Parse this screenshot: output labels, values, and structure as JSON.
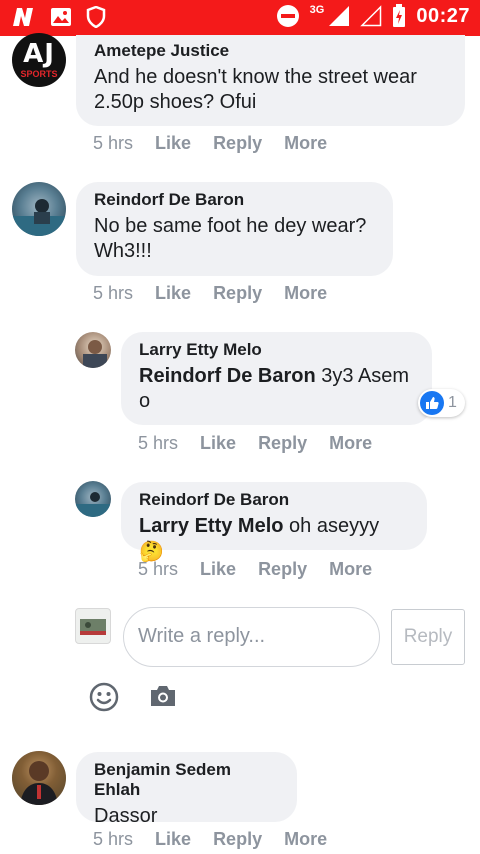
{
  "status_bar": {
    "network": "3G",
    "time": "00:27",
    "color": "#f41a1a"
  },
  "comments": [
    {
      "author": "Ametepe Justice",
      "text": "And he doesn't know the street wear 2.50p shoes? Ofui",
      "line1": "And he doesn't know the street wear",
      "line2": "2.50p shoes? Ofui",
      "time": "5 hrs",
      "like": "Like",
      "reply": "Reply",
      "more": "More",
      "avatar_text": "AJ",
      "avatar_sub": "SPORTS"
    },
    {
      "author": "Reindorf De Baron",
      "line1": "No be same foot he dey wear?",
      "line2": "Wh3!!!",
      "time": "5 hrs",
      "like": "Like",
      "reply": "Reply",
      "more": "More"
    },
    {
      "author": "Larry Etty Melo",
      "mention": "Reindorf De Baron",
      "line1_rest": " 3y3 Asem",
      "line2": "o",
      "reaction_count": "1",
      "time": "5 hrs",
      "like": "Like",
      "reply": "Reply",
      "more": "More"
    },
    {
      "author": "Reindorf De Baron",
      "mention": "Larry Etty Melo",
      "line1_rest": " oh aseyyy",
      "emoji": "🤔",
      "time": "5 hrs",
      "like": "Like",
      "reply": "Reply",
      "more": "More"
    },
    {
      "author": "Benjamin Sedem Ehlah",
      "line1": "Dassor",
      "time": "5 hrs",
      "like": "Like",
      "reply": "Reply",
      "more": "More"
    }
  ],
  "reply_composer": {
    "placeholder": "Write a reply...",
    "button": "Reply"
  },
  "icons": {
    "emoji": "smiley-icon",
    "camera": "camera-icon"
  }
}
